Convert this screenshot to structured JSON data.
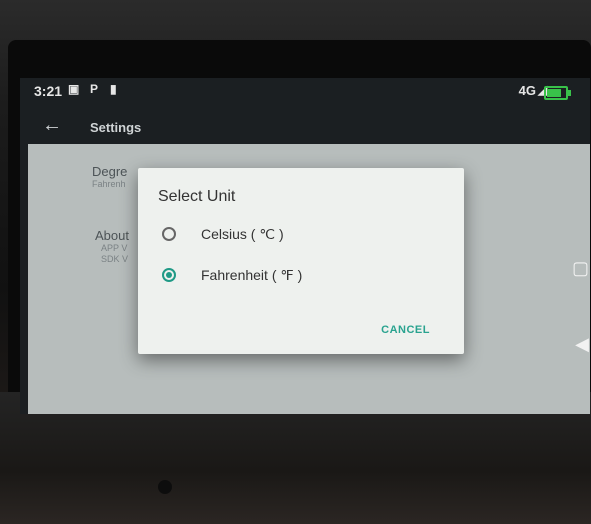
{
  "status_bar": {
    "time": "3:21",
    "network": "4G",
    "icons": [
      "message-icon",
      "p-icon",
      "sim-icon",
      "signal-icon",
      "battery-icon"
    ]
  },
  "toolbar": {
    "title": "Settings",
    "back_icon": "arrow-left-icon"
  },
  "settings": {
    "degree_title": "Degre",
    "degree_value": "Fahrenh",
    "about_title": "About",
    "app_version_label": "APP V",
    "sdk_version_label": "SDK V"
  },
  "dialog": {
    "title": "Select Unit",
    "options": [
      {
        "label": "Celsius ( ℃ )",
        "selected": false
      },
      {
        "label": "Fahrenheit ( ℉ )",
        "selected": true
      }
    ],
    "cancel_label": "CANCEL"
  },
  "colors": {
    "accent": "#1f9a86",
    "battery": "#39c24a"
  }
}
